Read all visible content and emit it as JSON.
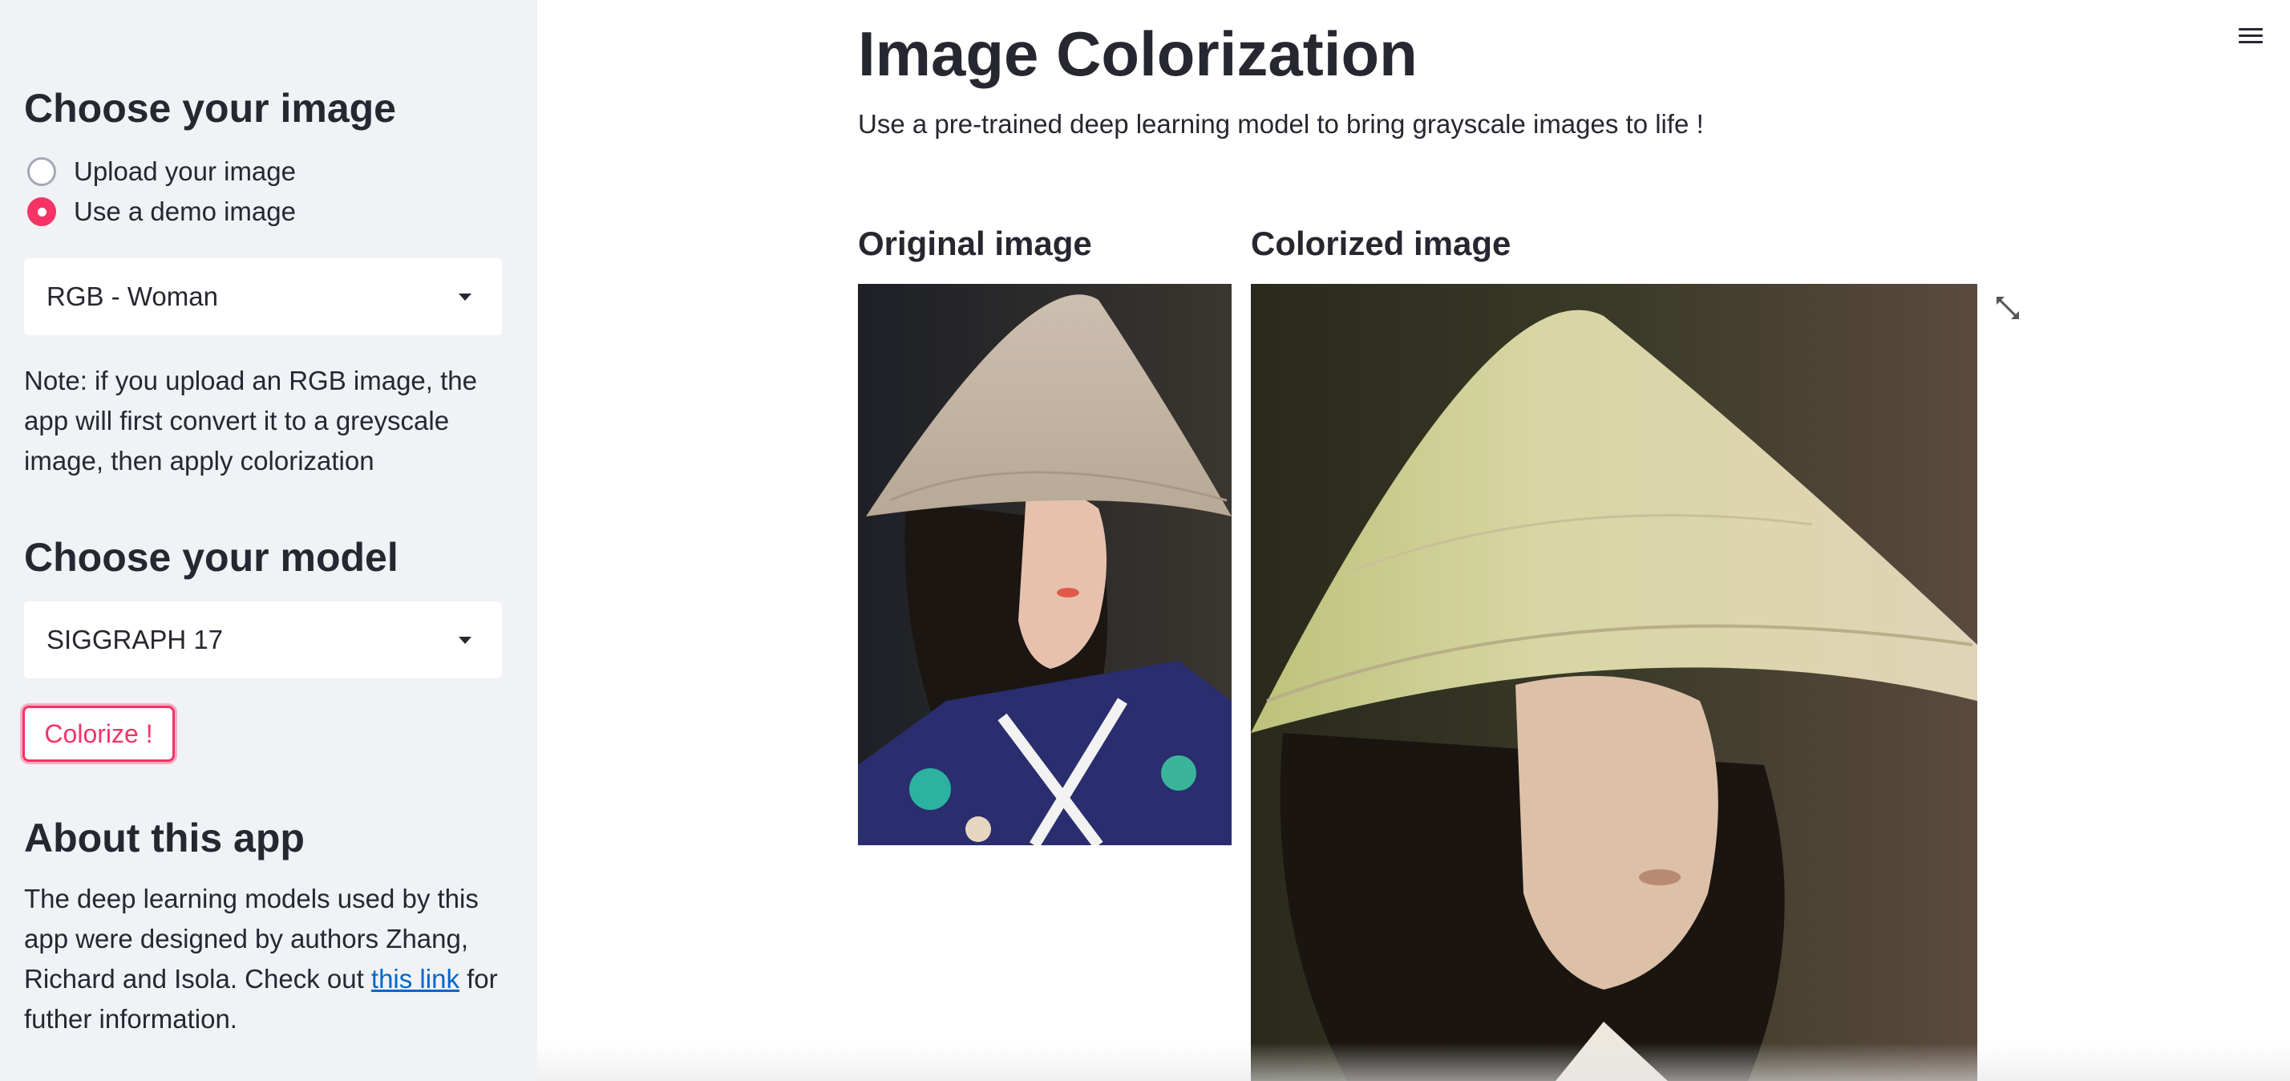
{
  "sidebar": {
    "choose_image_heading": "Choose your image",
    "radio_options": [
      {
        "label": "Upload your image",
        "checked": false
      },
      {
        "label": "Use a demo image",
        "checked": true
      }
    ],
    "image_select_value": "RGB - Woman",
    "note": "Note: if you upload an RGB image, the app will first convert it to a greyscale image, then apply colorization",
    "choose_model_heading": "Choose your model",
    "model_select_value": "SIGGRAPH 17",
    "colorize_label": "Colorize !",
    "about_heading": "About this app",
    "about_text_before": "The deep learning models used by this app were designed by authors Zhang, Richard and Isola. Check out ",
    "about_link": "this link",
    "about_text_after": " for futher information."
  },
  "main": {
    "title": "Image Colorization",
    "subtitle": "Use a pre-trained deep learning model to bring grayscale images to life !",
    "original_heading": "Original image",
    "colorized_heading": "Colorized image"
  },
  "icons": {
    "menu": "hamburger-menu-icon",
    "fullscreen": "fullscreen-expand-icon",
    "caret": "caret-down-icon"
  },
  "colors": {
    "accent": "#f63366",
    "sidebar_bg": "#f0f2f6",
    "link": "#0068c9",
    "text": "#262730"
  }
}
